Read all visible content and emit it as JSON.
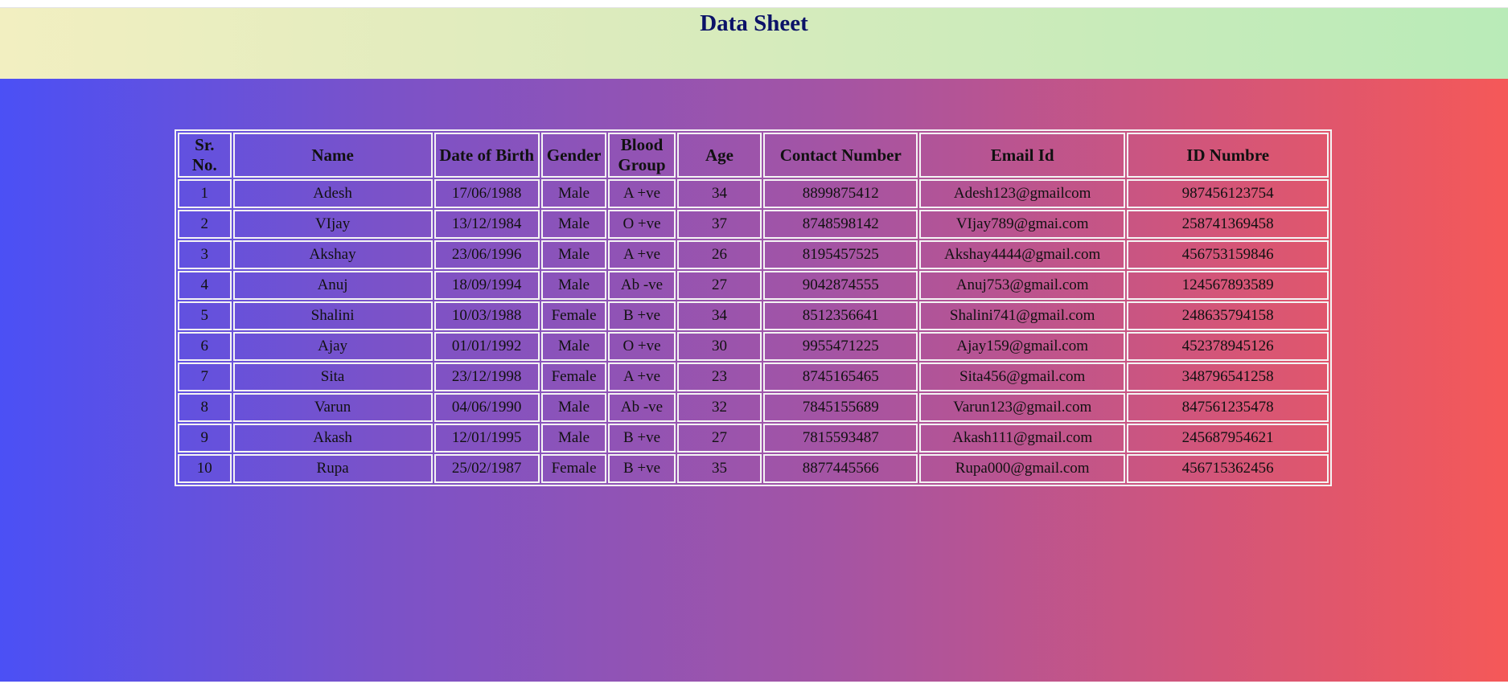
{
  "page": {
    "title": "Data Sheet"
  },
  "colors": {
    "title": "#0b1268",
    "header_gradient": [
      "#f2efc1",
      "#b9ebb8"
    ],
    "main_gradient": [
      "#4b50f5",
      "#f55858"
    ],
    "table_border": "#f4f4f4"
  },
  "table": {
    "headers": [
      "Sr. No.",
      "Name",
      "Date of Birth",
      "Gender",
      "Blood Group",
      "Age",
      "Contact Number",
      "Email Id",
      "ID Numbre"
    ],
    "rows": [
      [
        "1",
        "Adesh",
        "17/06/1988",
        "Male",
        "A +ve",
        "34",
        "8899875412",
        "Adesh123@gmailcom",
        "987456123754"
      ],
      [
        "2",
        "VIjay",
        "13/12/1984",
        "Male",
        "O +ve",
        "37",
        "8748598142",
        "VIjay789@gmai.com",
        "258741369458"
      ],
      [
        "3",
        "Akshay",
        "23/06/1996",
        "Male",
        "A +ve",
        "26",
        "8195457525",
        "Akshay4444@gmail.com",
        "456753159846"
      ],
      [
        "4",
        "Anuj",
        "18/09/1994",
        "Male",
        "Ab -ve",
        "27",
        "9042874555",
        "Anuj753@gmail.com",
        "124567893589"
      ],
      [
        "5",
        "Shalini",
        "10/03/1988",
        "Female",
        "B +ve",
        "34",
        "8512356641",
        "Shalini741@gmail.com",
        "248635794158"
      ],
      [
        "6",
        "Ajay",
        "01/01/1992",
        "Male",
        "O +ve",
        "30",
        "9955471225",
        "Ajay159@gmail.com",
        "452378945126"
      ],
      [
        "7",
        "Sita",
        "23/12/1998",
        "Female",
        "A +ve",
        "23",
        "8745165465",
        "Sita456@gmail.com",
        "348796541258"
      ],
      [
        "8",
        "Varun",
        "04/06/1990",
        "Male",
        "Ab -ve",
        "32",
        "7845155689",
        "Varun123@gmail.com",
        "847561235478"
      ],
      [
        "9",
        "Akash",
        "12/01/1995",
        "Male",
        "B +ve",
        "27",
        "7815593487",
        "Akash111@gmail.com",
        "245687954621"
      ],
      [
        "10",
        "Rupa",
        "25/02/1987",
        "Female",
        "B +ve",
        "35",
        "8877445566",
        "Rupa000@gmail.com",
        "456715362456"
      ]
    ]
  }
}
